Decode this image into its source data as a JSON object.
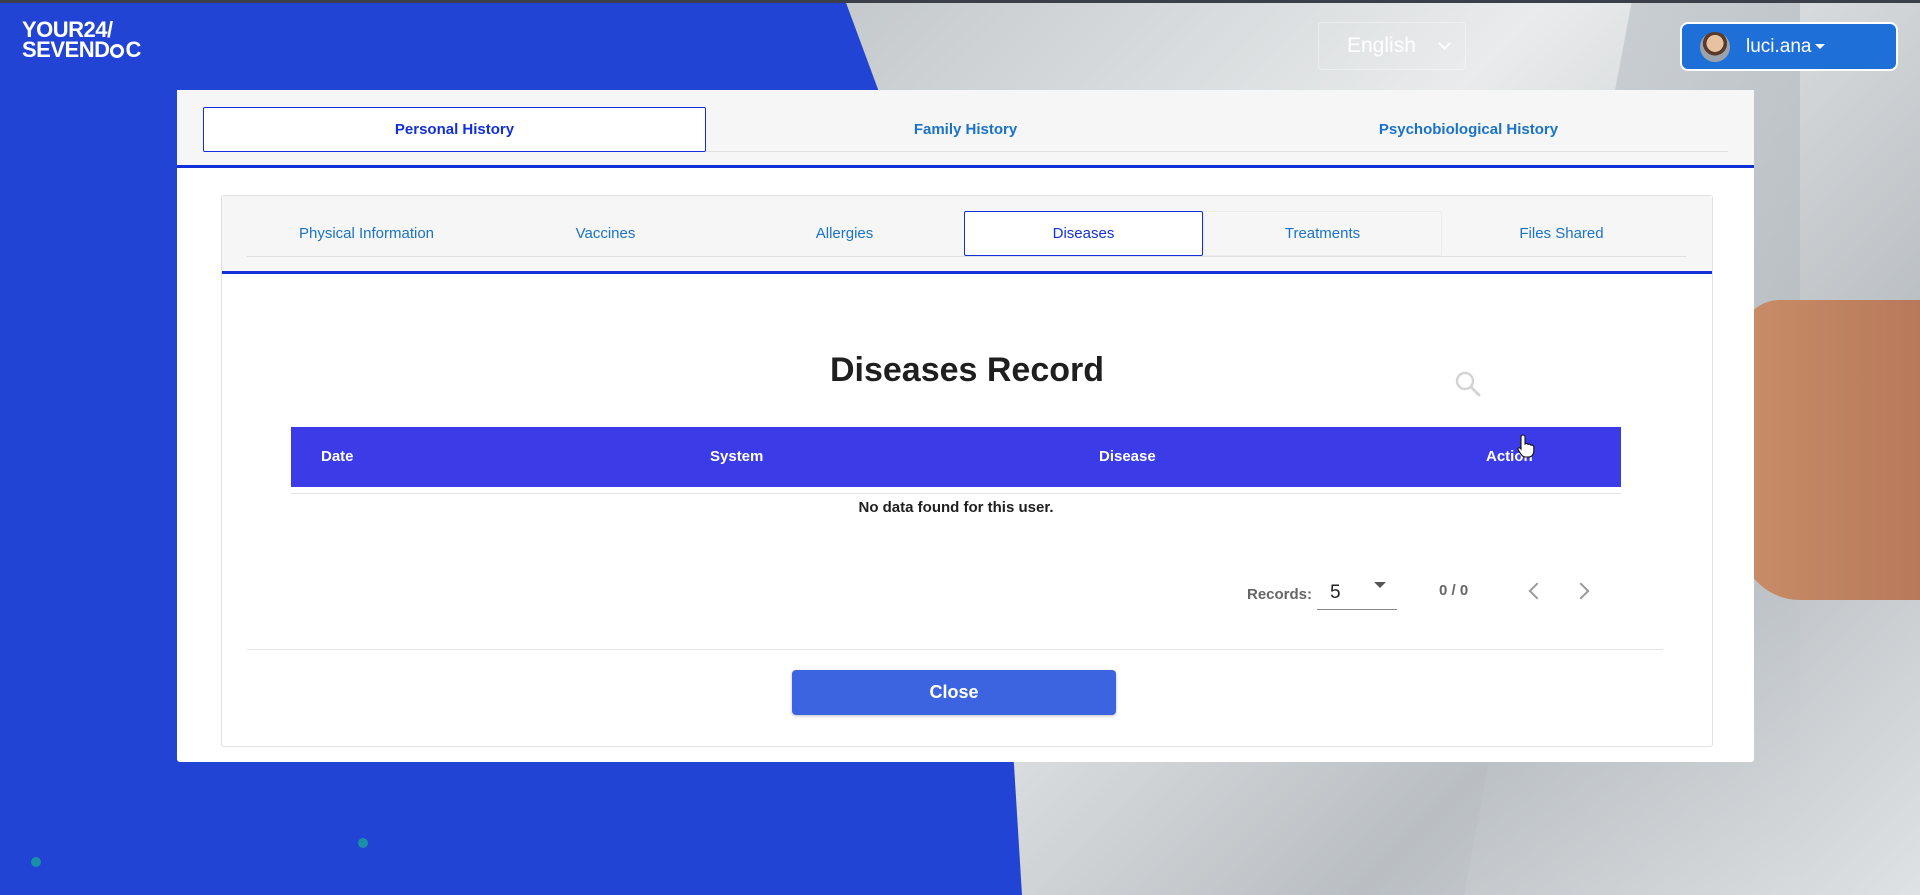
{
  "header": {
    "logo_line1": "YOUR24/",
    "logo_line2a": "SEVEND",
    "logo_line2b": "C",
    "language": "English",
    "username": "luci.ana"
  },
  "top_tabs": [
    {
      "label": "Personal History",
      "active": true
    },
    {
      "label": "Family History",
      "active": false
    },
    {
      "label": "Psychobiological History",
      "active": false
    }
  ],
  "sub_tabs": [
    {
      "label": "Physical Information"
    },
    {
      "label": "Vaccines"
    },
    {
      "label": "Allergies"
    },
    {
      "label": "Diseases",
      "active": true
    },
    {
      "label": "Treatments"
    },
    {
      "label": "Files Shared"
    }
  ],
  "record": {
    "title": "Diseases Record",
    "columns": [
      "Date",
      "System",
      "Disease",
      "Action"
    ],
    "empty_message": "No data found for this user."
  },
  "pagination": {
    "records_label": "Records:",
    "records_value": "5",
    "page_info": "0 / 0"
  },
  "close_label": "Close",
  "colors": {
    "brand_blue": "#2244d4",
    "tab_accent": "#1330d8",
    "table_header": "#3b3be8",
    "close_button": "#3c63e0",
    "link": "#1a73c8"
  },
  "icons": [
    "search-icon",
    "chevron-down-icon",
    "caret-down-icon",
    "chevron-left-icon",
    "chevron-right-icon",
    "hand-pointer-icon"
  ]
}
